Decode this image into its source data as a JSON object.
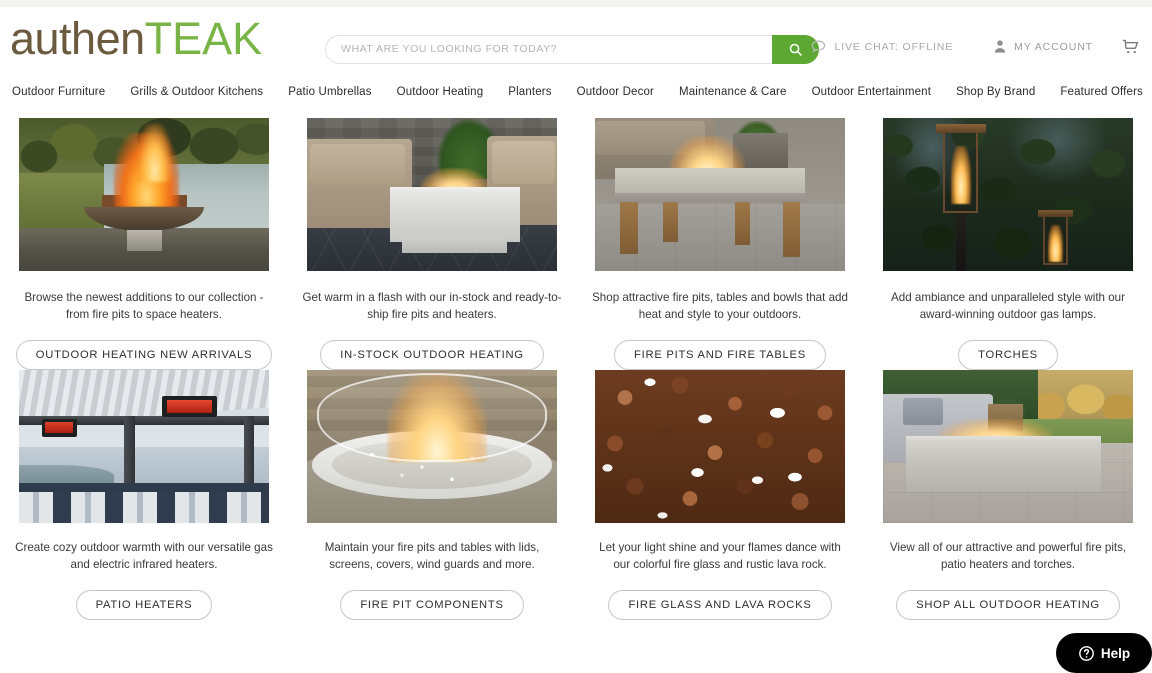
{
  "brand": {
    "logo_part1": "authen",
    "logo_part2": "TEAK",
    "color_brown": "#6b5a3e",
    "color_green": "#79b446",
    "color_search_button": "#5da832"
  },
  "search": {
    "placeholder": "WHAT ARE YOU LOOKING FOR TODAY?",
    "value": "",
    "icon": "search-icon"
  },
  "header_links": {
    "live_chat": "LIVE CHAT: OFFLINE",
    "live_chat_icon": "chat-bubble-icon",
    "my_account": "MY ACCOUNT",
    "my_account_icon": "user-icon",
    "cart_icon": "shopping-cart-icon"
  },
  "nav": {
    "items": [
      {
        "label": "Outdoor Furniture"
      },
      {
        "label": "Grills & Outdoor Kitchens"
      },
      {
        "label": "Patio Umbrellas"
      },
      {
        "label": "Outdoor Heating"
      },
      {
        "label": "Planters"
      },
      {
        "label": "Outdoor Decor"
      },
      {
        "label": "Maintenance & Care"
      },
      {
        "label": "Outdoor Entertainment"
      },
      {
        "label": "Shop By Brand"
      },
      {
        "label": "Featured Offers"
      }
    ]
  },
  "cards": [
    {
      "description": "Browse the newest additions to our collection - from fire pits to space heaters.",
      "button": "OUTDOOR HEATING NEW ARRIVALS",
      "image_alt": "fire-bowl-by-lake"
    },
    {
      "description": "Get warm in a flash with our in-stock and ready-to-ship fire pits and heaters.",
      "button": "IN-STOCK OUTDOOR HEATING",
      "image_alt": "wicker-patio-set-with-concrete-fire-table"
    },
    {
      "description": "Shop attractive fire pits, tables and bowls that add heat and style to your outdoors.",
      "button": "FIRE PITS AND FIRE TABLES",
      "image_alt": "wood-leg-fire-table"
    },
    {
      "description": "Add ambiance and unparalleled style with our award-winning outdoor gas lamps.",
      "button": "TORCHES",
      "image_alt": "outdoor-gas-torches-at-dusk"
    },
    {
      "description": "Create cozy outdoor warmth with our versatile gas and electric infrared heaters.",
      "button": "PATIO HEATERS",
      "image_alt": "pergola-with-infrared-patio-heaters"
    },
    {
      "description": "Maintain your fire pits and tables with lids, screens, covers, wind guards and more.",
      "button": "FIRE PIT COMPONENTS",
      "image_alt": "round-fire-pit-with-glass-wind-guard"
    },
    {
      "description": "Let your light shine and your flames dance with our colorful fire glass and rustic lava rock.",
      "button": "FIRE GLASS AND LAVA ROCKS",
      "image_alt": "copper-fire-glass-closeup"
    },
    {
      "description": "View all of our attractive and powerful fire pits, patio heaters and torches.",
      "button": "SHOP ALL OUTDOOR HEATING",
      "image_alt": "linear-concrete-fire-table-on-patio"
    }
  ],
  "help_widget": {
    "label": "Help",
    "icon": "question-mark-circle-icon",
    "background": "#000000"
  }
}
